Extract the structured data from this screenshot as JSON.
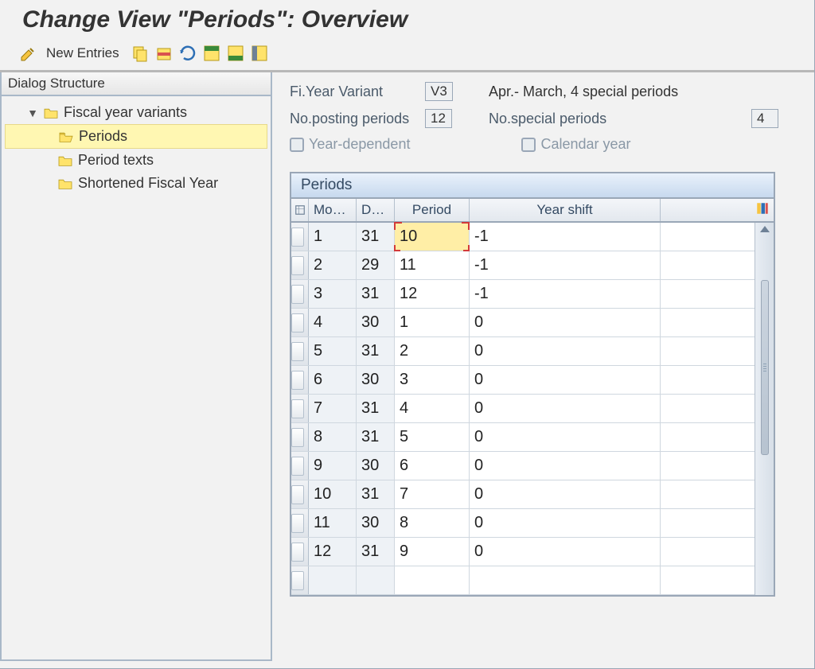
{
  "title": "Change View \"Periods\": Overview",
  "toolbar": {
    "new_entries": "New Entries"
  },
  "tree": {
    "header": "Dialog Structure",
    "root": "Fiscal year variants",
    "children": [
      {
        "label": "Periods",
        "selected": true,
        "open": true
      },
      {
        "label": "Period texts"
      },
      {
        "label": "Shortened Fiscal Year"
      }
    ]
  },
  "info": {
    "variant_label": "Fi.Year Variant",
    "variant_value": "V3",
    "variant_desc": "Apr.- March, 4 special periods",
    "posting_label": "No.posting periods",
    "posting_value": "12",
    "special_label": "No.special periods",
    "special_value": "4",
    "year_dep_label": "Year-dependent",
    "calendar_label": "Calendar year"
  },
  "table": {
    "title": "Periods",
    "headers": {
      "month": "Mo…",
      "day": "D…",
      "period": "Period",
      "year_shift": "Year shift"
    },
    "rows": [
      {
        "month": "1",
        "day": "31",
        "period": "10",
        "year_shift": "-1",
        "focused": true
      },
      {
        "month": "2",
        "day": "29",
        "period": "11",
        "year_shift": "-1"
      },
      {
        "month": "3",
        "day": "31",
        "period": "12",
        "year_shift": "-1"
      },
      {
        "month": "4",
        "day": "30",
        "period": "1",
        "year_shift": "0"
      },
      {
        "month": "5",
        "day": "31",
        "period": "2",
        "year_shift": "0"
      },
      {
        "month": "6",
        "day": "30",
        "period": "3",
        "year_shift": "0"
      },
      {
        "month": "7",
        "day": "31",
        "period": "4",
        "year_shift": "0"
      },
      {
        "month": "8",
        "day": "31",
        "period": "5",
        "year_shift": "0"
      },
      {
        "month": "9",
        "day": "30",
        "period": "6",
        "year_shift": "0"
      },
      {
        "month": "10",
        "day": "31",
        "period": "7",
        "year_shift": "0"
      },
      {
        "month": "11",
        "day": "30",
        "period": "8",
        "year_shift": "0"
      },
      {
        "month": "12",
        "day": "31",
        "period": "9",
        "year_shift": "0"
      }
    ]
  }
}
